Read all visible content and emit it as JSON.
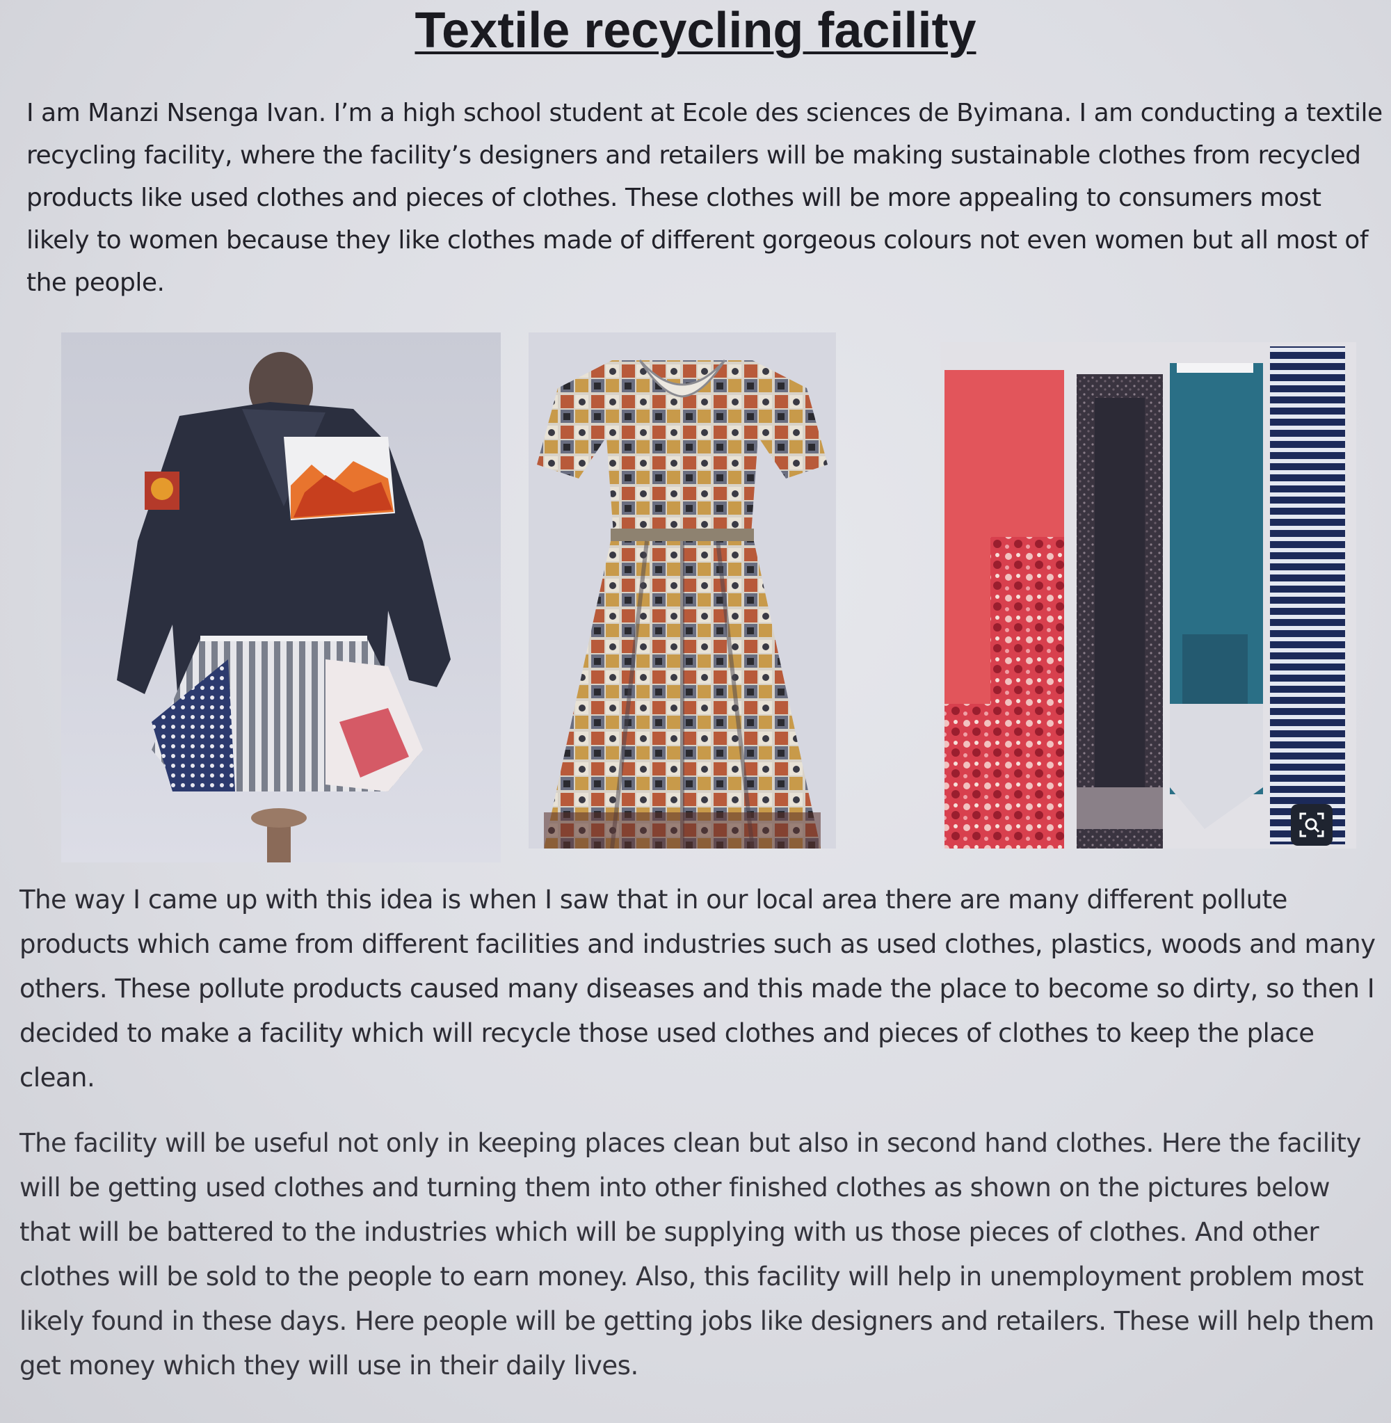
{
  "document": {
    "title": "Textile recycling facility",
    "intro": "I am Manzi Nsenga Ivan. I’m a high school student at Ecole des sciences de Byimana. I am conducting a textile recycling facility, where the facility’s designers and retailers will be making sustainable clothes from recycled products like used clothes and pieces of clothes. These clothes will be more appealing to consumers most likely to women because they like clothes made of different gorgeous colours not even women but all most of the people.",
    "paragraph_1": "The way I came up with this idea is when I saw that in our local area there are many different pollute products which came from different facilities and industries such as used clothes, plastics, woods and many others. These pollute products caused many diseases and this made the place to become so dirty, so then I decided   to make a facility which will recycle those used clothes and pieces of clothes   to keep the place clean.",
    "paragraph_2": "The facility will be useful not only in keeping places clean but also in second hand clothes. Here the facility will be getting used clothes and turning them into other finished clothes as shown on the pictures below that will be battered to the industries which will be supplying with us those pieces of clothes. And other clothes will be sold to the people to earn money. Also, this facility will help in unemployment problem most likely found in   these days. Here people will be getting jobs like designers and retailers. These will help them get money which they will use in their daily lives."
  },
  "images": [
    {
      "icon": "patchwork-jacket-photo"
    },
    {
      "icon": "comic-print-dress-photo"
    },
    {
      "icon": "fabric-strips-photo"
    }
  ],
  "lens_badge": {
    "icon": "image-search-icon"
  },
  "colors": {
    "page_background": "#dcdde3",
    "text": "#25252e",
    "denim": "#2b2f3f",
    "coral_fabric": "#e2555b",
    "teal_fabric": "#2a6f86",
    "navy_stripe": "#1c2a5a"
  }
}
